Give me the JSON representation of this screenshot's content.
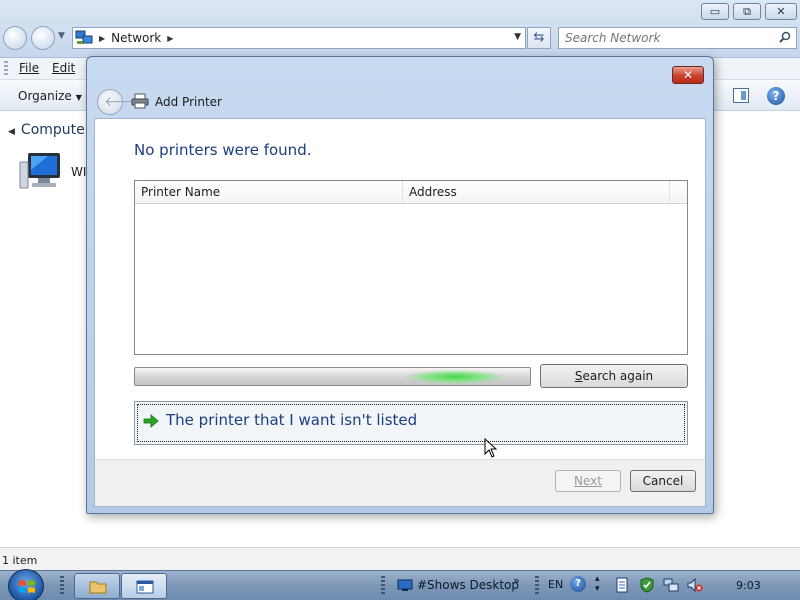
{
  "explorer": {
    "address_crumb": "Network",
    "search_placeholder": "Search Network",
    "menu": {
      "file": "File",
      "edit": "Edit"
    },
    "toolbar": {
      "organize": "Organize"
    },
    "nav_tree": {
      "computer": "Computer"
    },
    "computer_item_label": "WI",
    "status": "1 item",
    "window_controls": {
      "minimize": "▭",
      "maximize": "⧉",
      "close": "✕"
    }
  },
  "dialog": {
    "title": "Add Printer",
    "close_glyph": "✕",
    "heading": "No printers were found.",
    "list": {
      "columns": [
        "Printer Name",
        "Address"
      ],
      "rows": []
    },
    "progress": {
      "state": "searching",
      "glow_position": 0.73
    },
    "search_again": {
      "mnemonic": "S",
      "rest": "earch again"
    },
    "not_listed": "The printer that I want isn't listed",
    "buttons": {
      "next": "Next",
      "cancel": "Cancel"
    }
  },
  "taskbar": {
    "desktop_toolbar": "#Shows Desktop",
    "chevron": "»",
    "language": "EN",
    "help_glyph": "?",
    "clock": "9:03",
    "tray_icons": [
      "document-icon",
      "shield-check-icon",
      "network-icon",
      "volume-muted-icon"
    ]
  },
  "colors": {
    "heading_blue": "#1c3d82",
    "progress_glow": "#45d84a",
    "close_red": "#c8412c"
  }
}
